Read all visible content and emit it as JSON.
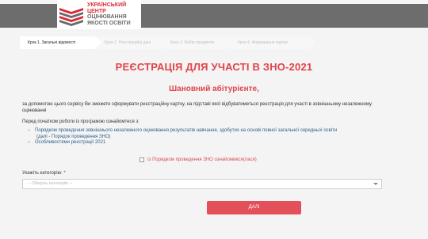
{
  "header": {
    "logo_lines": [
      "УКРАЇНСЬКИЙ",
      "ЦЕНТР",
      "ОЦІНЮВАННЯ",
      "ЯКОСТІ ОСВІТИ"
    ],
    "colors": {
      "band": "#6d6d6d",
      "brand_red": "#d92b33"
    }
  },
  "steps": [
    {
      "label": "Крок 1. Загальні відомості",
      "active": true
    },
    {
      "label": "Крок 2. Реєстраційні дані",
      "active": false
    },
    {
      "label": "Крок 3. Вибір предметів",
      "active": false
    },
    {
      "label": "Крок 4. Формування картки",
      "active": false
    }
  ],
  "main": {
    "title": "РЕЄСТРАЦІЯ ДЛЯ УЧАСТІ В ЗНО-2021",
    "subtitle": "Шановний абітурієнте,",
    "intro": "за допомогою цього сервісу Ви зможете сформувати реєстраційну картку, на підставі якої відбуватиметься реєстрація для участі в зовнішньому незалежному оцінюванні",
    "before_text": "Перед початком роботи із програмою ознайомтеся з:",
    "links": [
      {
        "line1": "Порядком проведення зовнішнього незалежного оцінювання результатів навчання, здобутих на основі повної загальної середньої освіти",
        "line2": "(далі - Порядок проведення ЗНО)"
      },
      {
        "line1": "Особливостями реєстрації 2021",
        "line2": ""
      }
    ],
    "agree_label": "Із Порядком проведення ЗНО ознайомився(лася)",
    "category_label": "Укажіть категорію:",
    "category_required": "*",
    "category_placeholder": "-- Оберіть категорію --",
    "next_button": "ДАЛІ"
  }
}
